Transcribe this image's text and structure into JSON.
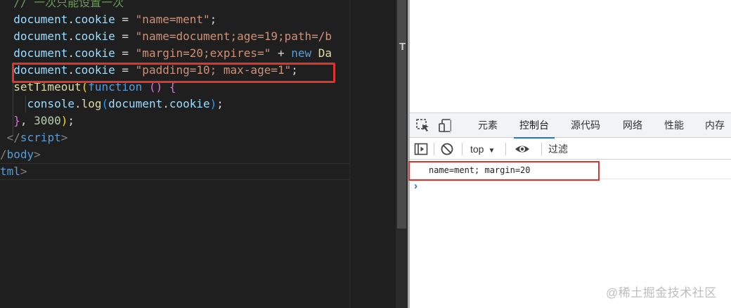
{
  "editor": {
    "lines": [
      {
        "segments": [
          {
            "t": "  ",
            "c": "pu"
          },
          {
            "t": "// 一次只能设置一次",
            "c": "cm"
          }
        ]
      },
      {
        "segments": [
          {
            "t": "  ",
            "c": "pu"
          },
          {
            "t": "document",
            "c": "id"
          },
          {
            "t": ".",
            "c": "pu"
          },
          {
            "t": "cookie",
            "c": "id"
          },
          {
            "t": " = ",
            "c": "pu"
          },
          {
            "t": "\"name=ment\"",
            "c": "str"
          },
          {
            "t": ";",
            "c": "pu"
          }
        ]
      },
      {
        "segments": [
          {
            "t": "  ",
            "c": "pu"
          },
          {
            "t": "document",
            "c": "id"
          },
          {
            "t": ".",
            "c": "pu"
          },
          {
            "t": "cookie",
            "c": "id"
          },
          {
            "t": " = ",
            "c": "pu"
          },
          {
            "t": "\"name=document;age=19;path=/b",
            "c": "str"
          }
        ]
      },
      {
        "segments": [
          {
            "t": "  ",
            "c": "pu"
          },
          {
            "t": "document",
            "c": "id"
          },
          {
            "t": ".",
            "c": "pu"
          },
          {
            "t": "cookie",
            "c": "id"
          },
          {
            "t": " = ",
            "c": "pu"
          },
          {
            "t": "\"margin=20;expires=\"",
            "c": "str"
          },
          {
            "t": " + ",
            "c": "pu"
          },
          {
            "t": "new",
            "c": "kw"
          },
          {
            "t": " ",
            "c": "pu"
          },
          {
            "t": "Da",
            "c": "fn"
          }
        ]
      },
      {
        "segments": [
          {
            "t": "  ",
            "c": "pu"
          },
          {
            "t": "document",
            "c": "id"
          },
          {
            "t": ".",
            "c": "pu"
          },
          {
            "t": "cookie",
            "c": "id"
          },
          {
            "t": " = ",
            "c": "pu"
          },
          {
            "t": "\"padding=10; max-age=1\"",
            "c": "str"
          },
          {
            "t": ";",
            "c": "pu"
          }
        ]
      },
      {
        "segments": [
          {
            "t": "  ",
            "c": "pu"
          },
          {
            "t": "setTimeout",
            "c": "fn"
          },
          {
            "t": "(",
            "c": "br1"
          },
          {
            "t": "function",
            "c": "kw"
          },
          {
            "t": " ",
            "c": "pu"
          },
          {
            "t": "()",
            "c": "br2"
          },
          {
            "t": " ",
            "c": "pu"
          },
          {
            "t": "{",
            "c": "br2"
          }
        ]
      },
      {
        "segments": [
          {
            "t": "    ",
            "c": "pu"
          },
          {
            "t": "console",
            "c": "id"
          },
          {
            "t": ".",
            "c": "pu"
          },
          {
            "t": "log",
            "c": "fn"
          },
          {
            "t": "(",
            "c": "br3"
          },
          {
            "t": "document",
            "c": "id"
          },
          {
            "t": ".",
            "c": "pu"
          },
          {
            "t": "cookie",
            "c": "id"
          },
          {
            "t": ")",
            "c": "br3"
          },
          {
            "t": ";",
            "c": "pu"
          }
        ]
      },
      {
        "segments": [
          {
            "t": "  ",
            "c": "pu"
          },
          {
            "t": "}",
            "c": "br2"
          },
          {
            "t": ", ",
            "c": "pu"
          },
          {
            "t": "3000",
            "c": "num"
          },
          {
            "t": ")",
            "c": "br1"
          },
          {
            "t": ";",
            "c": "pu"
          }
        ]
      },
      {
        "segments": [
          {
            "t": " </",
            "c": "tag"
          },
          {
            "t": "script",
            "c": "tname"
          },
          {
            "t": ">",
            "c": "tag"
          }
        ]
      },
      {
        "segments": [
          {
            "t": "/",
            "c": "tag"
          },
          {
            "t": "body",
            "c": "tname"
          },
          {
            "t": ">",
            "c": "tag"
          }
        ]
      },
      {
        "segments": [
          {
            "t": "tml",
            "c": "tname"
          },
          {
            "t": ">",
            "c": "tag"
          }
        ]
      }
    ]
  },
  "devtools": {
    "tabs": [
      {
        "label": "元素",
        "active": false
      },
      {
        "label": "控制台",
        "active": true
      },
      {
        "label": "源代码",
        "active": false
      },
      {
        "label": "网络",
        "active": false
      },
      {
        "label": "性能",
        "active": false
      },
      {
        "label": "内存",
        "active": false
      }
    ],
    "context": "top",
    "filter_placeholder": "过滤",
    "console_output": "name=ment; margin=20",
    "prompt_symbol": "›"
  },
  "watermark": "@稀土掘金技术社区",
  "colors": {
    "highlight": "#e0332c",
    "accent": "#1a73e8"
  },
  "icons": [
    "inspect-icon",
    "device-toggle-icon",
    "sidebar-toggle-icon",
    "clear-console-icon",
    "eye-icon"
  ]
}
